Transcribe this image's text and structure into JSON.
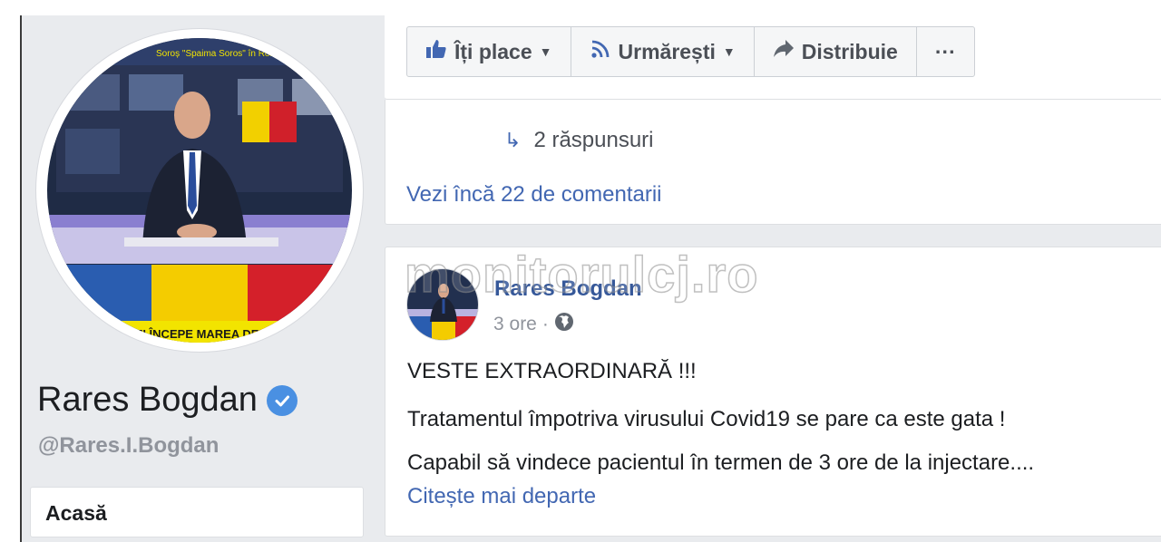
{
  "profile": {
    "photo_text_top": "Soroș \"Spaima Soros\" în România",
    "photo_text_bottom": "AZI ÎNCEPE MAREA DEM",
    "name": "Rares Bogdan",
    "handle": "@Rares.I.Bogdan",
    "verified_icon": "verified-check-icon"
  },
  "nav": {
    "home_label": "Acasă"
  },
  "actions": {
    "like": {
      "label": "Îți place",
      "icon": "thumbs-up-icon"
    },
    "follow": {
      "label": "Urmărești",
      "icon": "rss-icon"
    },
    "share": {
      "label": "Distribuie",
      "icon": "share-arrow-icon"
    },
    "more": {
      "label": "···",
      "icon": "more-icon"
    }
  },
  "comments": {
    "replies_label": "2 răspunsuri",
    "more_comments_label": "Vezi încă 22 de comentarii"
  },
  "post": {
    "author": "Rares Bogdan",
    "time": "3 ore",
    "separator": "·",
    "audience_icon": "globe-icon",
    "lines": [
      "VESTE EXTRAORDINARĂ !!!",
      "Tratamentul împotriva virusului Covid19 se pare ca este gata !",
      "Capabil să vindece pacientul în termen de 3 ore de la injectare...."
    ],
    "read_more": "Citește mai departe"
  },
  "watermark": "monitorulcj.ro",
  "colors": {
    "link_blue": "#4267b2",
    "author_blue": "#365899",
    "verified_blue": "#4a90e2",
    "page_bg": "#e9ebee"
  }
}
